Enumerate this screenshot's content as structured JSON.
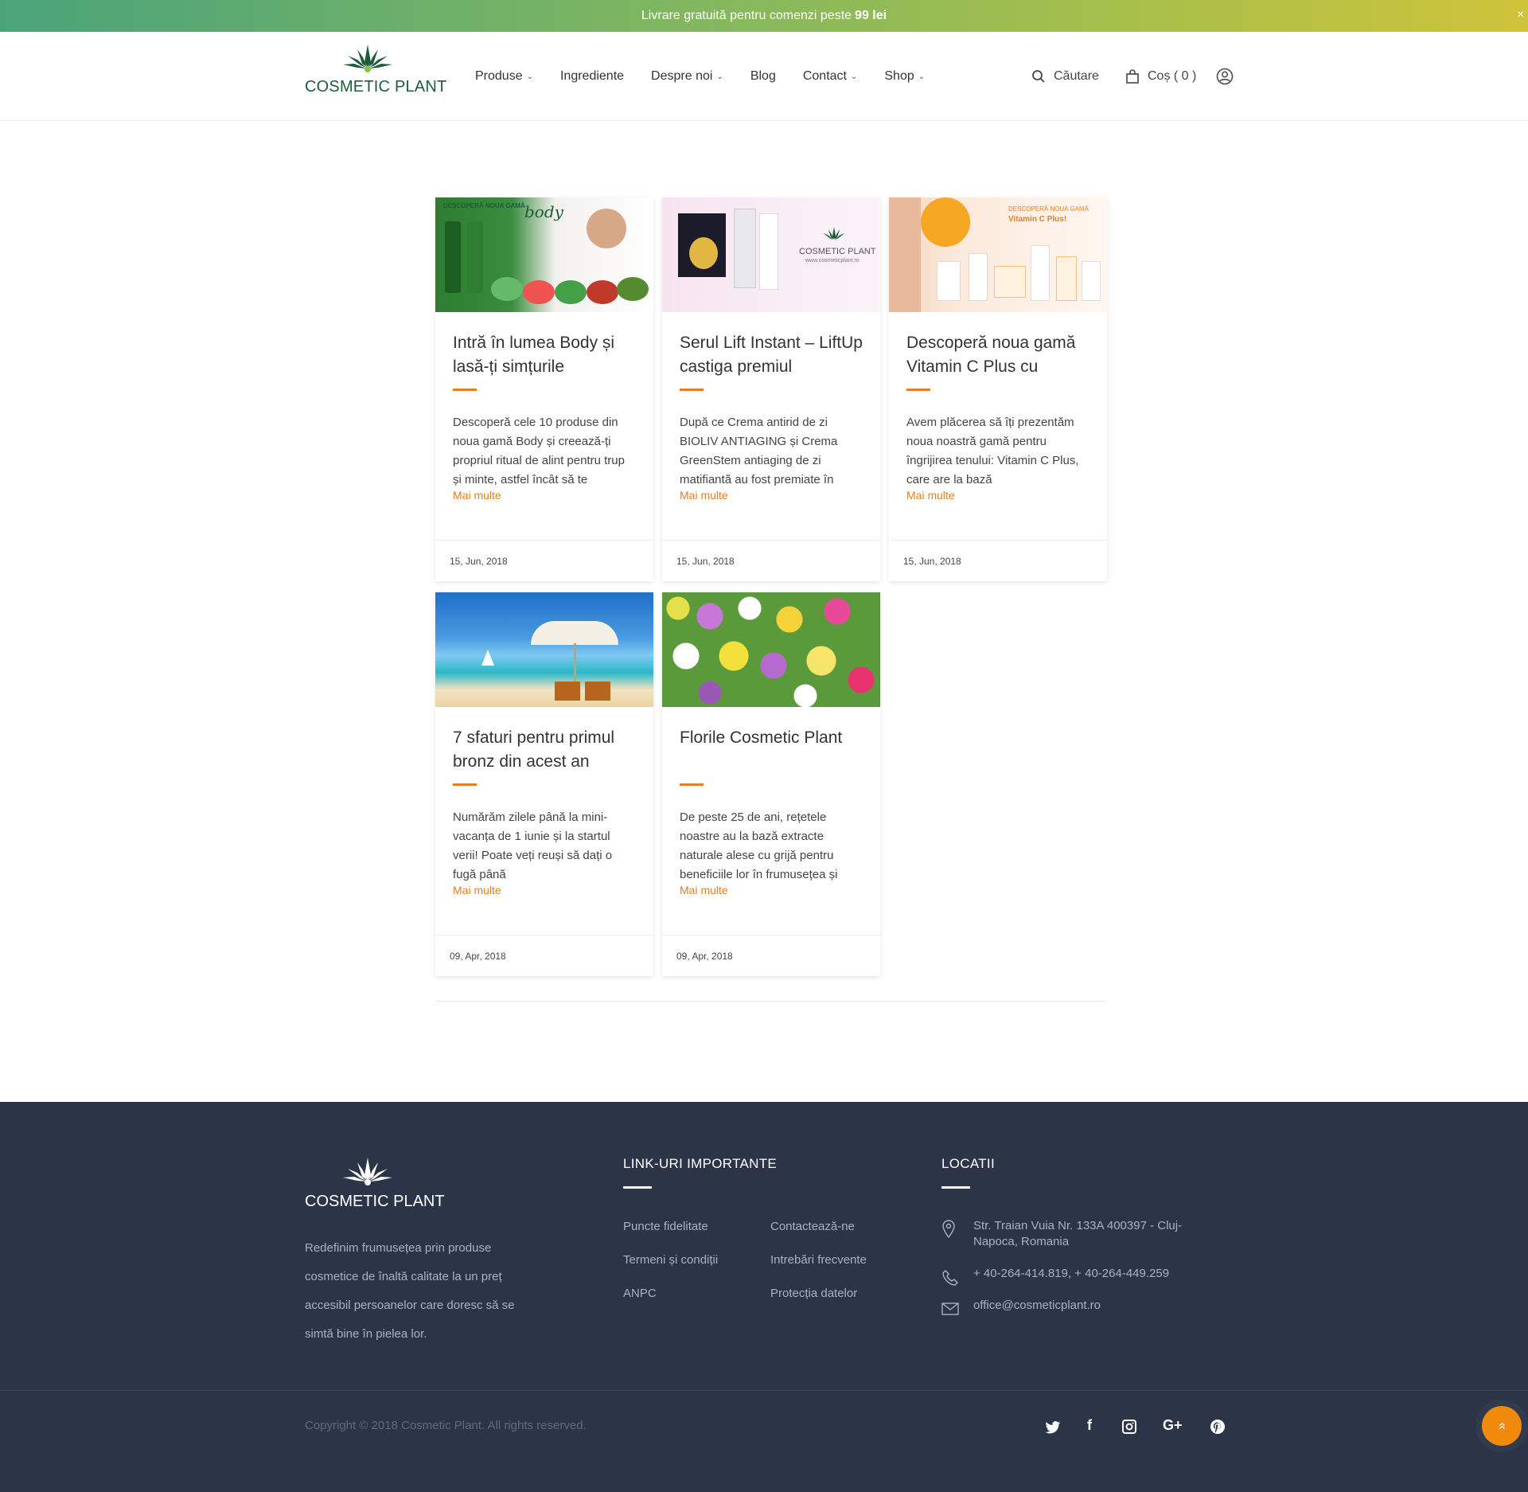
{
  "promo": {
    "text": "Livrare gratuită pentru comenzi peste",
    "amount": "99 lei",
    "close": "×"
  },
  "header": {
    "logo_main": "COSMETIC",
    "logo_sub": "PLANT",
    "nav": [
      {
        "label": "Produse",
        "has_dropdown": true
      },
      {
        "label": "Ingrediente",
        "has_dropdown": false
      },
      {
        "label": "Despre noi",
        "has_dropdown": true
      },
      {
        "label": "Blog",
        "has_dropdown": false
      },
      {
        "label": "Contact",
        "has_dropdown": true
      },
      {
        "label": "Shop",
        "has_dropdown": true
      }
    ],
    "chevron": "⌄",
    "search_label": "Căutare",
    "cart_label": "Coș ( 0 )"
  },
  "posts": [
    {
      "title": "Intră în lumea Body și lasă-ți simțurile",
      "excerpt": "Descoperă cele 10 produse din noua gamă Body și creează-ți propriul ritual de alint pentru trup și minte, astfel încât să te",
      "more": "Mai multe",
      "date": "15, Jun, 2018",
      "image_caption_1": "DESCOPERĂ NOUA GAMĂ",
      "image_caption_2": "body"
    },
    {
      "title": "Serul Lift Instant – LiftUp castiga premiul",
      "excerpt": "După ce Crema antirid de zi BIOLIV ANTIAGING și Crema GreenStem antiaging de zi matifiantă au fost premiate în",
      "more": "Mai multe",
      "date": "15, Jun, 2018",
      "image_caption_1": "COSMETIC PLANT",
      "image_caption_2": "www.cosmeticplant.ro"
    },
    {
      "title": "Descoperă noua gamă Vitamin C Plus cu",
      "excerpt": "Avem plăcerea să îți prezentăm noua noastră gamă pentru îngrijirea tenului: Vitamin C Plus, care are la bază",
      "more": "Mai multe",
      "date": "15, Jun, 2018",
      "image_caption_1": "DESCOPERĂ NOUA GAMĂ",
      "image_caption_2": "Vitamin C Plus!"
    },
    {
      "title": "7 sfaturi pentru primul bronz din acest an",
      "excerpt": "Numărăm zilele până la mini-vacanța de 1 iunie și la startul verii! Poate veți reuși să dați o fugă până",
      "more": "Mai multe",
      "date": "09, Apr, 2018"
    },
    {
      "title": "Florile Cosmetic Plant",
      "excerpt": "De peste 25 de ani, rețetele noastre au la bază extracte naturale alese cu grijă pentru beneficiile lor în frumusețea și",
      "more": "Mai multe",
      "date": "09, Apr, 2018"
    }
  ],
  "footer": {
    "logo_main": "COSMETIC",
    "logo_sub": "PLANT",
    "about": "Redefinim frumusețea prin produse cosmetice de înaltă calitate la un preț accesibil persoanelor care doresc să se simtă bine în pielea lor.",
    "links_heading": "LINK-URI IMPORTANTE",
    "links_col1": [
      "Puncte fidelitate",
      "Termeni și condiții",
      "ANPC"
    ],
    "links_col2": [
      "Contactează-ne",
      "Intrebări frecvente",
      "Protecția datelor"
    ],
    "locations_heading": "LOCATII",
    "address": "Str. Traian Vuia Nr. 133A 400397 - Cluj-Napoca, Romania",
    "phone": "+ 40-264-414.819, + 40-264-449.259",
    "email": "office@cosmeticplant.ro",
    "copyright": "Copyright © 2018 Cosmetic Plant. All rights reserved.",
    "social": [
      "twitter-icon",
      "facebook-icon",
      "instagram-icon",
      "google-plus-icon",
      "pinterest-icon"
    ],
    "social_glyphs": {
      "facebook": "f",
      "google_plus": "G+"
    }
  },
  "back_to_top": "»",
  "colors": {
    "accent": "#e67e22",
    "footer_bg": "#2c3548",
    "brand_green": "#1e5b3a"
  }
}
